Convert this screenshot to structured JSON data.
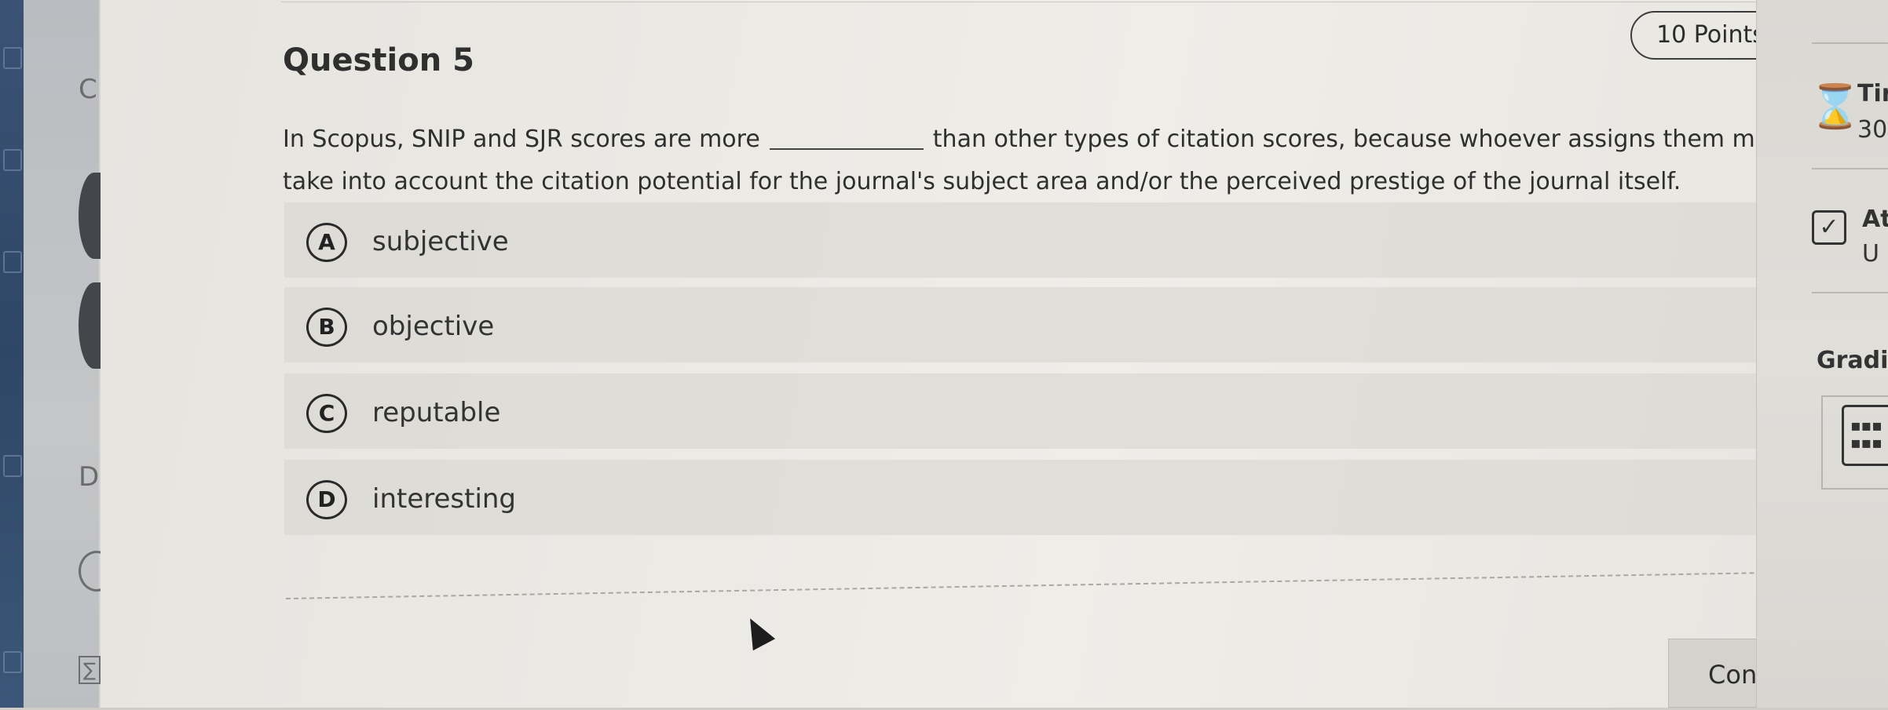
{
  "question": {
    "title": "Question 5",
    "points": "10 Points",
    "stem_part1": "In Scopus, SNIP and SJR scores are more",
    "stem_part2": "than other types of citation scores, because whoever assigns them must",
    "stem_line2": "take into account the citation potential for the journal's subject area and/or the perceived prestige of the journal itself."
  },
  "choices": [
    {
      "letter": "A",
      "text": "subjective"
    },
    {
      "letter": "B",
      "text": "objective"
    },
    {
      "letter": "C",
      "text": "reputable"
    },
    {
      "letter": "D",
      "text": "interesting"
    }
  ],
  "footer": {
    "continue_label": "Continue"
  },
  "left_panel": {
    "letter_top": "C",
    "letter_bottom": "D"
  },
  "sidebar": {
    "timer_label": "Tir",
    "timer_value": "30",
    "attempt_label": "At",
    "attempt_value": "U",
    "grading_label": "Gradir"
  }
}
